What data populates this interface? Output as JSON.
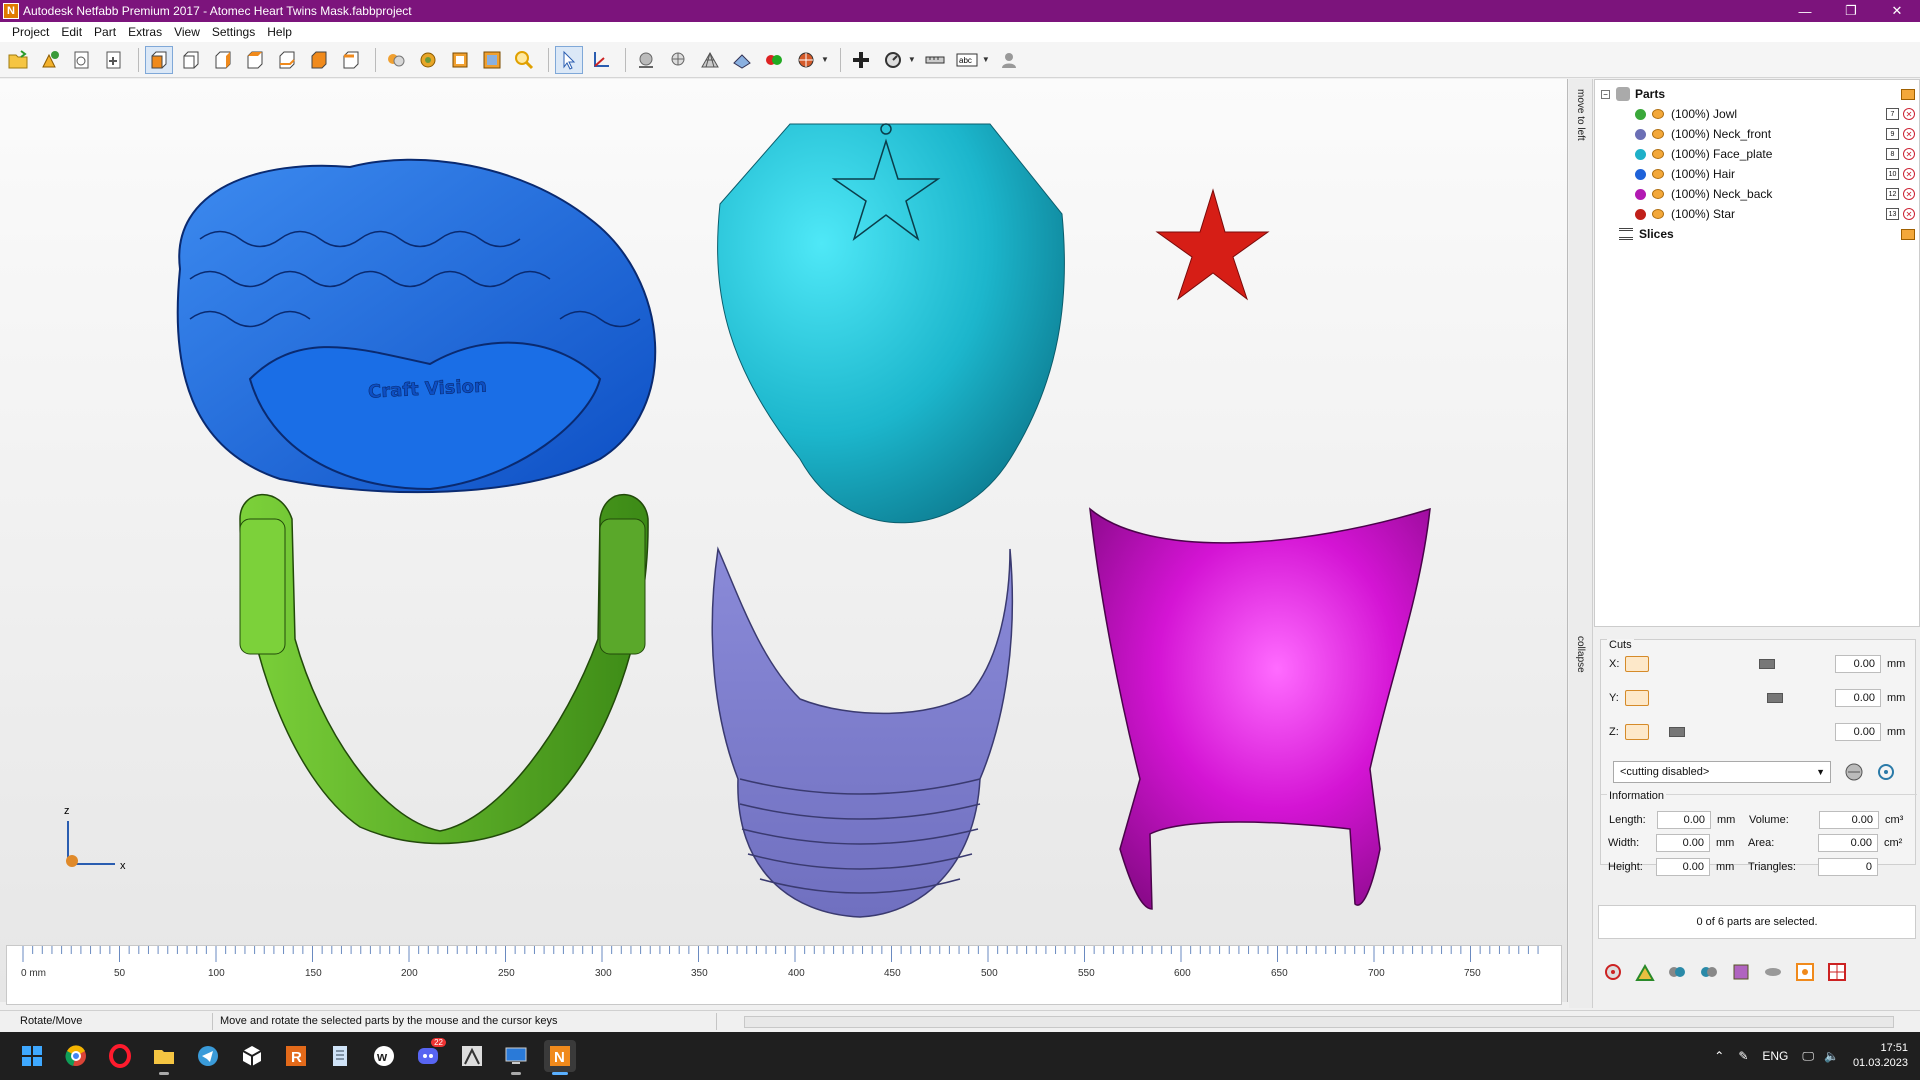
{
  "window": {
    "title": "Autodesk Netfabb Premium 2017 - Atomec Heart Twins Mask.fabbproject",
    "app_icon_letter": "N",
    "minimize": "—",
    "restore": "❐",
    "close": "✕"
  },
  "menu": [
    "Project",
    "Edit",
    "Part",
    "Extras",
    "View",
    "Settings",
    "Help"
  ],
  "viewport": {
    "embossed_text": "Craft Vision",
    "axis_z": "z",
    "axis_x": "x",
    "ruler_labels": [
      "0 mm",
      "50",
      "100",
      "150",
      "200",
      "250",
      "300",
      "350",
      "400",
      "450",
      "500",
      "550",
      "600",
      "650",
      "700",
      "750"
    ]
  },
  "side_tabs": {
    "move_to_left": "move to left",
    "collapse": "collapse"
  },
  "tree": {
    "root": "Parts",
    "parts": [
      {
        "label": "(100%) Jowl",
        "color": "#3aa83a",
        "num": "7"
      },
      {
        "label": "(100%) Neck_front",
        "color": "#6b6fb5",
        "num": "9"
      },
      {
        "label": "(100%) Face_plate",
        "color": "#1fb0c8",
        "num": "8"
      },
      {
        "label": "(100%) Hair",
        "color": "#1f62d9",
        "num": "10"
      },
      {
        "label": "(100%) Neck_back",
        "color": "#b21ab2",
        "num": "12"
      },
      {
        "label": "(100%) Star",
        "color": "#c0201a",
        "num": "13"
      }
    ],
    "slices": "Slices"
  },
  "cuts": {
    "title": "Cuts",
    "x_label": "X:",
    "y_label": "Y:",
    "z_label": "Z:",
    "x_value": "0.00",
    "y_value": "0.00",
    "z_value": "0.00",
    "unit": "mm",
    "mode": "<cutting disabled>"
  },
  "information": {
    "title": "Information",
    "length_label": "Length:",
    "width_label": "Width:",
    "height_label": "Height:",
    "volume_label": "Volume:",
    "area_label": "Area:",
    "triangles_label": "Triangles:",
    "length": "0.00",
    "width": "0.00",
    "height": "0.00",
    "volume": "0.00",
    "area": "0.00",
    "triangles": "0",
    "mm": "mm",
    "cm3": "cm³",
    "cm2": "cm²"
  },
  "selection_status": "0 of 6 parts are selected.",
  "statusbar": {
    "mode": "Rotate/Move",
    "hint": "Move and rotate the selected parts by the mouse and the cursor keys"
  },
  "taskbar": {
    "lang": "ENG",
    "time": "17:51",
    "date": "01.03.2023",
    "discord_badge": "22"
  }
}
